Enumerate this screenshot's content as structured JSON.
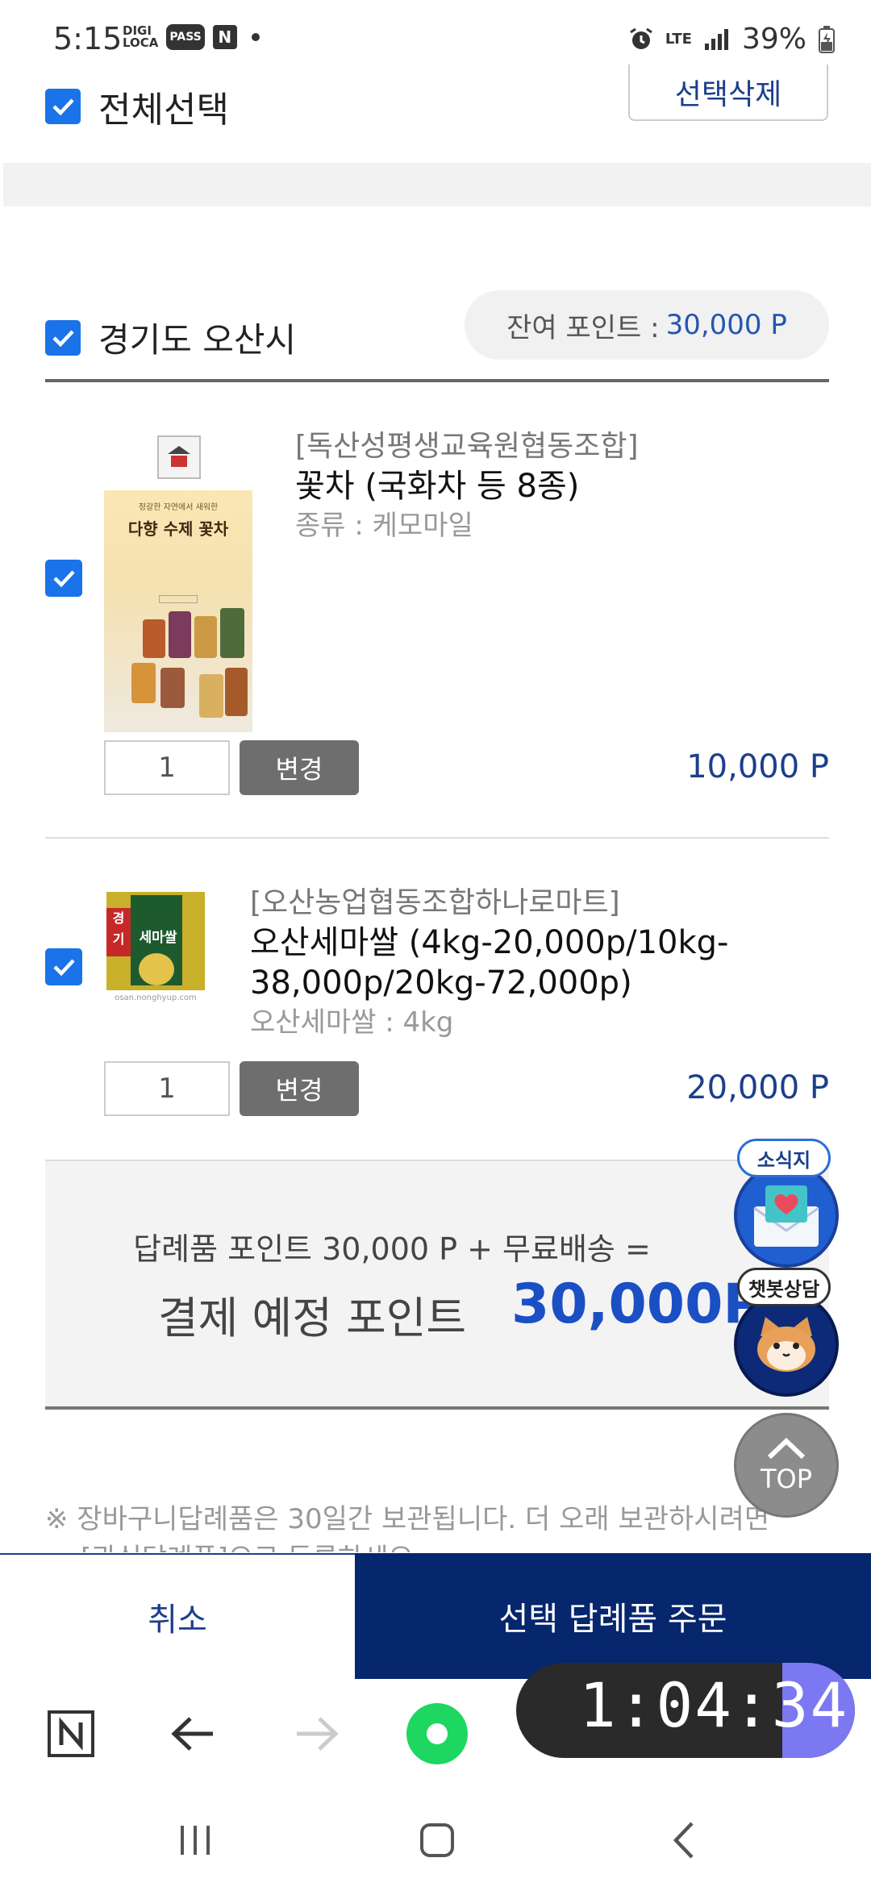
{
  "status_bar": {
    "time": "5:15",
    "icons_left": [
      "DIGI LOCA",
      "PASS",
      "N"
    ],
    "network": "LTE",
    "battery": "39%"
  },
  "top": {
    "select_all_label": "전체선택",
    "delete_selected_label": "선택삭제"
  },
  "region": {
    "name": "경기도 오산시",
    "remaining_label": "잔여 포인트 :",
    "remaining_value": "30,000 P"
  },
  "items": [
    {
      "seller": "[독산성평생교육원협동조합]",
      "name": "꽃차 (국화차 등 8종)",
      "option": "종류 : 케모마일",
      "thumb_title": "다향 수제 꽃차",
      "thumb_sub": "정갈한 자연에서 새워한",
      "quantity": "1",
      "change_label": "변경",
      "price": "10,000 P"
    },
    {
      "seller": "[오산농업협동조합하나로마트]",
      "name": "오산세마쌀 (4kg-20,000p/10kg-38,000p/20kg-72,000p)",
      "option": "오산세마쌀 : 4kg",
      "thumb_title": "세마쌀",
      "thumb_sub": "osan.nonghyup.com",
      "quantity": "1",
      "change_label": "변경",
      "price": "20,000 P"
    }
  ],
  "summary": {
    "line1": "답례품 포인트 30,000 P + 무료배송 =",
    "label": "결제 예정 포인트",
    "total": "30,000P"
  },
  "notice": {
    "line1": "※ 장바구니답례품은 30일간 보관됩니다. 더 오래 보관하시려면",
    "line2": "[관심답례품]으로 등록하세요."
  },
  "floating": {
    "news_label": "소식지",
    "chatbot_label": "챗봇상담",
    "top_label": "TOP"
  },
  "actions": {
    "cancel_label": "취소",
    "order_label": "선택 답례품 주문"
  },
  "timer": "1:04:34",
  "colors": {
    "navy": "#06266e",
    "accent_blue": "#1b4fc4",
    "checkbox_blue": "#1a73e8",
    "timer_accent": "#7b78f2"
  }
}
